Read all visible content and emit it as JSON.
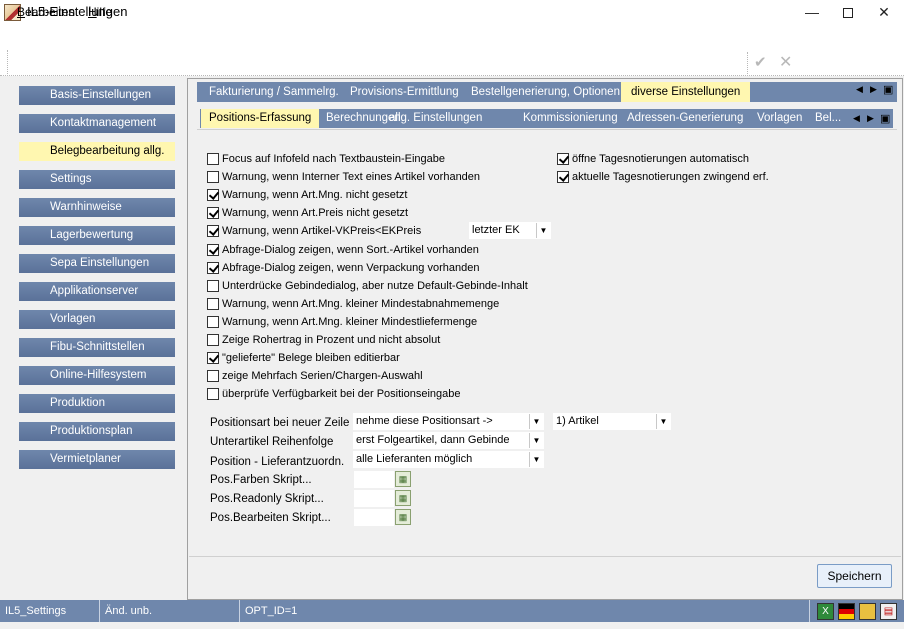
{
  "window": {
    "title": "IL5-Einstellungen",
    "minimize": "—",
    "close": "✕"
  },
  "menu": {
    "bearbeiten_u": "B",
    "bearbeiten_rest": "earbeiten",
    "hilfe_u": "H",
    "hilfe_rest": "ilfe"
  },
  "toolbar": {
    "confirm_glyph": "✔",
    "cancel_glyph": "✕"
  },
  "sidebar": {
    "items": [
      {
        "label": "Basis-Einstellungen"
      },
      {
        "label": "Kontaktmanagement"
      },
      {
        "label": "Belegbearbeitung allg.",
        "active": true
      },
      {
        "label": "Settings"
      },
      {
        "label": "Warnhinweise"
      },
      {
        "label": "Lagerbewertung"
      },
      {
        "label": "Sepa Einstellungen"
      },
      {
        "label": "Applikationserver"
      },
      {
        "label": "Vorlagen"
      },
      {
        "label": "Fibu-Schnittstellen"
      },
      {
        "label": "Online-Hilfesystem"
      },
      {
        "label": "Produktion"
      },
      {
        "label": "Produktionsplan"
      },
      {
        "label": "Vermietplaner"
      }
    ]
  },
  "tabs_top": [
    {
      "label": "Fakturierung / Sammelrg."
    },
    {
      "label": "Provisions-Ermittlung"
    },
    {
      "label": "Bestellgenerierung, Optionen"
    },
    {
      "label": "diverse Einstellungen",
      "active": true
    }
  ],
  "tabs_sub": [
    {
      "label": "Positions-Erfassung",
      "active": true
    },
    {
      "label": "Berechnungen"
    },
    {
      "label": "allg. Einstellungen"
    },
    {
      "label": "Kommissionierung"
    },
    {
      "label": "Adressen-Generierung"
    },
    {
      "label": "Vorlagen"
    },
    {
      "label": "Bel..."
    }
  ],
  "tab_nav": {
    "prev": "◀",
    "next": "▶",
    "menu": "▣"
  },
  "options_left": [
    {
      "label": "Focus auf Infofeld nach Textbaustein-Eingabe",
      "checked": false
    },
    {
      "label": "Warnung, wenn Interner Text eines Artikel vorhanden",
      "checked": false
    },
    {
      "label": "Warnung, wenn Art.Mng. nicht gesetzt",
      "checked": true
    },
    {
      "label": "Warnung, wenn Art.Preis nicht gesetzt",
      "checked": true
    },
    {
      "label": "Warnung, wenn Artikel-VKPreis<EKPreis",
      "checked": true
    },
    {
      "label": "Abfrage-Dialog zeigen, wenn Sort.-Artikel vorhanden",
      "checked": true
    },
    {
      "label": "Abfrage-Dialog zeigen, wenn Verpackung vorhanden",
      "checked": true
    },
    {
      "label": "Unterdrücke Gebindedialog, aber nutze Default-Gebinde-Inhalt",
      "checked": false
    },
    {
      "label": "Warnung, wenn Art.Mng. kleiner Mindestabnahmemenge",
      "checked": false
    },
    {
      "label": "Warnung, wenn Art.Mng. kleiner Mindestliefermenge",
      "checked": false
    },
    {
      "label": "Zeige Rohertrag in Prozent und nicht absolut",
      "checked": false
    },
    {
      "label": "\"gelieferte\" Belege bleiben editierbar",
      "checked": true
    },
    {
      "label": "zeige Mehrfach Serien/Chargen-Auswahl",
      "checked": false
    },
    {
      "label": "überprüfe Verfügbarkeit bei der Positionseingabe",
      "checked": false
    }
  ],
  "options_right": [
    {
      "label": "öffne Tagesnotierungen automatisch",
      "checked": true
    },
    {
      "label": "aktuelle Tagesnotierungen zwingend erf.",
      "checked": true
    }
  ],
  "ek_select": {
    "value": "letzter EK"
  },
  "form": {
    "positionsart_label": "Positionsart bei neuer Zeile",
    "positionsart_value": "nehme diese Positionsart ->",
    "positionsart_value2": "1) Artikel",
    "unterartikel_label": "Unterartikel Reihenfolge",
    "unterartikel_value": "erst Folgeartikel, dann Gebinde",
    "lieferant_label": "Position - Lieferantzuordn.",
    "lieferant_value": "alle Lieferanten möglich",
    "farben_label": "Pos.Farben Skript...",
    "readonly_label": "Pos.Readonly Skript...",
    "bearbeiten_label": "Pos.Bearbeiten Skript..."
  },
  "save_label": "Speichern",
  "status": {
    "cell1": "IL5_Settings",
    "cell2": "Änd. unb.",
    "cell3": "OPT_ID=1"
  },
  "colors": {
    "nav_blue": "#6f87ac",
    "active_yellow": "#fff7b0"
  }
}
